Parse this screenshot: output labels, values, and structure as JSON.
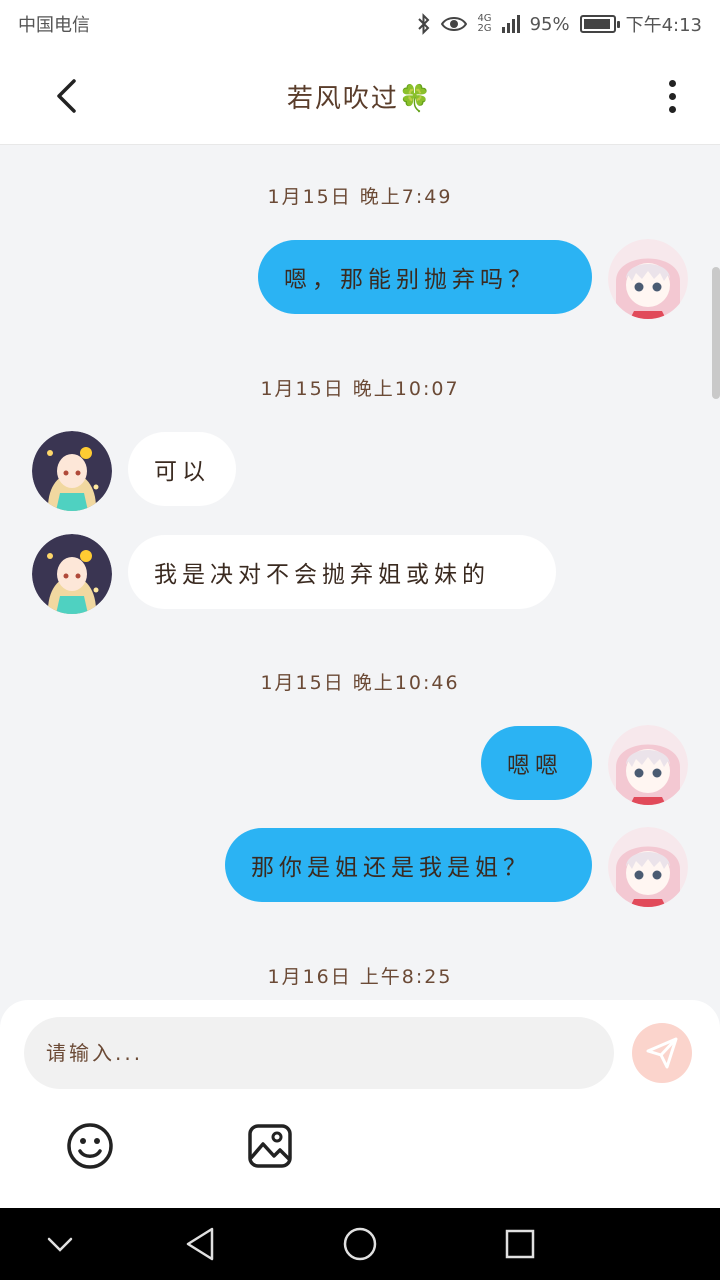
{
  "status_bar": {
    "carrier": "中国电信",
    "network_top": "4G",
    "network_bottom": "2G",
    "battery": "95%",
    "battery_level": 0.95,
    "time": "下午4:13"
  },
  "header": {
    "title": "若风吹过🍀"
  },
  "messages": [
    {
      "type": "time",
      "text": "1月15日 晚上7:49"
    },
    {
      "type": "out",
      "text": "嗯，那能别抛弃吗？"
    },
    {
      "type": "time",
      "text": "1月15日 晚上10:07"
    },
    {
      "type": "in",
      "text": "可以"
    },
    {
      "type": "in",
      "text": "我是决对不会抛弃姐或妹的"
    },
    {
      "type": "time",
      "text": "1月15日 晚上10:46"
    },
    {
      "type": "out",
      "text": "嗯嗯"
    },
    {
      "type": "out",
      "text": "那你是姐还是我是姐？"
    },
    {
      "type": "time",
      "text": "1月16日 上午8:25"
    }
  ],
  "composer": {
    "placeholder": "请输入...",
    "value": ""
  },
  "icons": {
    "back": "chevron-left-icon",
    "more": "more-vertical-icon",
    "send": "paper-plane-icon",
    "emoji": "smiley-icon",
    "image": "image-icon",
    "nav_back": "triangle-back-icon",
    "nav_home": "circle-home-icon",
    "nav_recent": "square-recent-icon",
    "nav_collapse": "chevron-down-icon"
  },
  "colors": {
    "outgoing_bubble": "#2bb3f3",
    "incoming_bubble": "#ffffff",
    "send_button": "#fbd4cc",
    "background": "#f3f4f6"
  }
}
